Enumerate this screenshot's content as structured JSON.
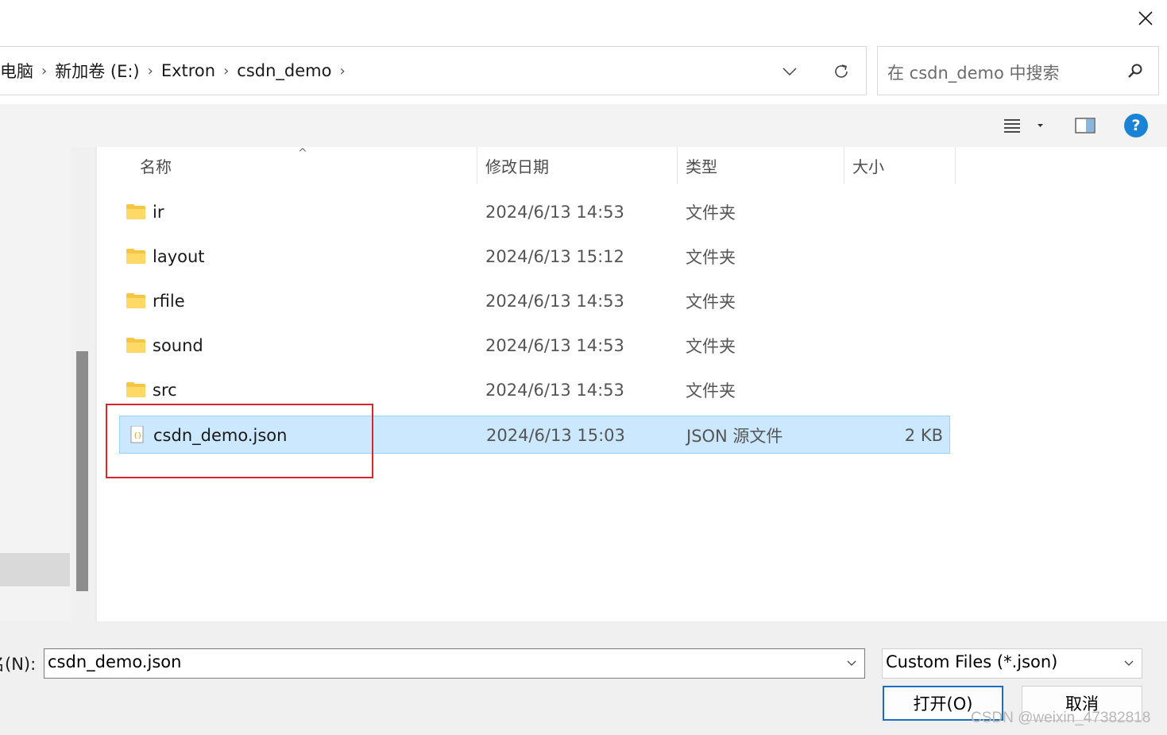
{
  "address": {
    "breadcrumb": [
      {
        "label": "此电脑"
      },
      {
        "label": "新加卷 (E:)"
      },
      {
        "label": "Extron"
      },
      {
        "label": "csdn_demo"
      }
    ]
  },
  "search": {
    "placeholder": "在 csdn_demo 中搜索"
  },
  "toolbar": {
    "help_label": "?"
  },
  "columns": {
    "name": "名称",
    "date": "修改日期",
    "type": "类型",
    "size": "大小"
  },
  "files": [
    {
      "name": "ir",
      "date": "2024/6/13 14:53",
      "type": "文件夹",
      "size": "",
      "kind": "folder-icon"
    },
    {
      "name": "layout",
      "date": "2024/6/13 15:12",
      "type": "文件夹",
      "size": "",
      "kind": "folder-icon"
    },
    {
      "name": "rfile",
      "date": "2024/6/13 14:53",
      "type": "文件夹",
      "size": "",
      "kind": "folder-icon"
    },
    {
      "name": "sound",
      "date": "2024/6/13 14:53",
      "type": "文件夹",
      "size": "",
      "kind": "folder-icon"
    },
    {
      "name": "src",
      "date": "2024/6/13 14:53",
      "type": "文件夹",
      "size": "",
      "kind": "folder-icon"
    },
    {
      "name": "csdn_demo.json",
      "date": "2024/6/13 15:03",
      "type": "JSON 源文件",
      "size": "2 KB",
      "kind": "json-file-icon",
      "selected": true
    }
  ],
  "bottom": {
    "filename_label": "名(N):",
    "filename_value": "csdn_demo.json",
    "filetype_value": "Custom Files (*.json)",
    "open_label": "打开(O)",
    "cancel_label": "取消"
  },
  "watermark": "CSDN @weixin_47382818",
  "colors": {
    "selection": "#cce8ff",
    "highlight": "#d9262c",
    "accent": "#1a83d6"
  }
}
